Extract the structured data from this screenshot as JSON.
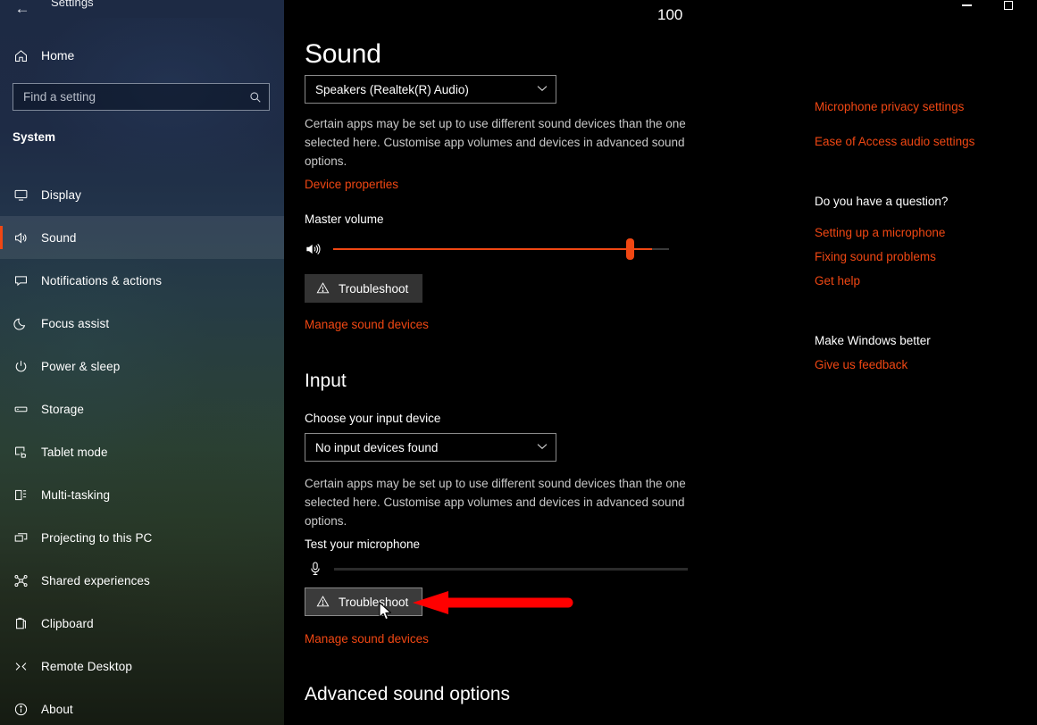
{
  "window": {
    "app_title": "Settings",
    "back_icon": "back-arrow-icon",
    "minimize_label": "–",
    "maximize_label": "□"
  },
  "sidebar": {
    "home_label": "Home",
    "home_icon": "home-icon",
    "search": {
      "placeholder": "Find a setting",
      "value": "",
      "icon": "search-icon"
    },
    "group_title": "System",
    "items": [
      {
        "label": "Display",
        "icon": "monitor-icon",
        "selected": false
      },
      {
        "label": "Sound",
        "icon": "speaker-icon",
        "selected": true
      },
      {
        "label": "Notifications & actions",
        "icon": "chat-bubble-icon",
        "selected": false
      },
      {
        "label": "Focus assist",
        "icon": "moon-icon",
        "selected": false
      },
      {
        "label": "Power & sleep",
        "icon": "power-icon",
        "selected": false
      },
      {
        "label": "Storage",
        "icon": "drive-icon",
        "selected": false
      },
      {
        "label": "Tablet mode",
        "icon": "tablet-hand-icon",
        "selected": false
      },
      {
        "label": "Multi-tasking",
        "icon": "multitask-icon",
        "selected": false
      },
      {
        "label": "Projecting to this PC",
        "icon": "project-icon",
        "selected": false
      },
      {
        "label": "Shared experiences",
        "icon": "share-nodes-icon",
        "selected": false
      },
      {
        "label": "Clipboard",
        "icon": "clipboard-icon",
        "selected": false
      },
      {
        "label": "Remote Desktop",
        "icon": "remote-desktop-icon",
        "selected": false
      },
      {
        "label": "About",
        "icon": "info-icon",
        "selected": false
      }
    ]
  },
  "main": {
    "page_title": "Sound",
    "output": {
      "device_value": "Speakers (Realtek(R) Audio)",
      "chevron": "chevron-down-icon",
      "description": "Certain apps may be set up to use different sound devices than the one selected here. Customise app volumes and devices in advanced sound options.",
      "device_properties_link": "Device properties",
      "master_volume_label": "Master volume",
      "volume_value": "100",
      "volume_icon": "speaker-volume-icon",
      "troubleshoot_label": "Troubleshoot",
      "troubleshoot_icon": "warning-triangle-icon",
      "manage_link": "Manage sound devices"
    },
    "input": {
      "heading": "Input",
      "choose_label": "Choose your input device",
      "device_value": "No input devices found",
      "chevron": "chevron-down-icon",
      "description": "Certain apps may be set up to use different sound devices than the one selected here. Customise app volumes and devices in advanced sound options.",
      "test_mic_label": "Test your microphone",
      "mic_icon": "microphone-icon",
      "mic_level": "0",
      "troubleshoot_label": "Troubleshoot",
      "troubleshoot_icon": "warning-triangle-icon",
      "manage_link": "Manage sound devices"
    },
    "advanced_heading": "Advanced sound options"
  },
  "related": {
    "links_top": [
      "Microphone privacy settings",
      "Ease of Access audio settings"
    ],
    "question_heading": "Do you have a question?",
    "question_links": [
      "Setting up a microphone",
      "Fixing sound problems",
      "Get help"
    ],
    "feedback_heading": "Make Windows better",
    "feedback_link": "Give us feedback"
  },
  "annotation": {
    "arrow_color": "#ff0000",
    "arrow_direction": "left",
    "points_at": "input-troubleshoot-button",
    "cursor_icon": "mouse-pointer-icon"
  },
  "colors": {
    "accent": "#f04713",
    "background": "#000000",
    "sidebar_top": "#1d2a44",
    "annotation_red": "#ff0000"
  }
}
